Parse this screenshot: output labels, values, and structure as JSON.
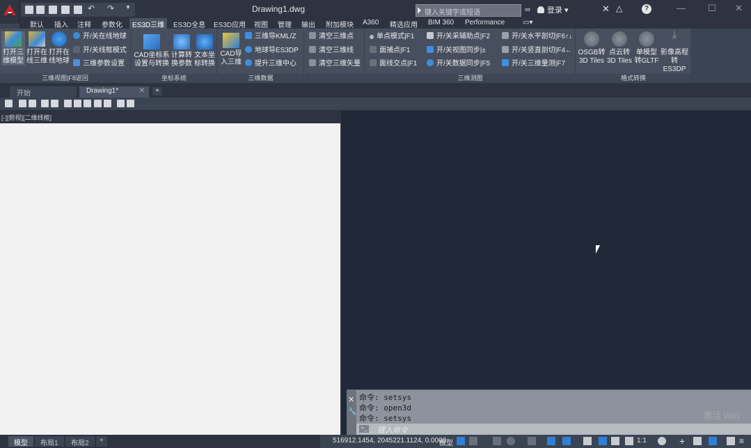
{
  "title": "Drawing1.dwg",
  "search": {
    "placeholder": "键入关键字或短语"
  },
  "login": "登录",
  "menu_tabs": [
    "默认",
    "插入",
    "注释",
    "参数化",
    "ES3D三维",
    "ES3D全息",
    "ES3D应用",
    "视图",
    "管理",
    "输出",
    "附加模块",
    "A360",
    "精选应用",
    "BIM 360",
    "Performance"
  ],
  "ribbon": {
    "panel1": {
      "title": "三维视图|F8返回",
      "big": [
        {
          "label1": "打开三",
          "label2": "维模型"
        },
        {
          "label1": "打开在",
          "label2": "线三维"
        },
        {
          "label1": "打开在",
          "label2": "线地球"
        }
      ],
      "small": [
        "开/关在线地球",
        "开/关线框模式",
        "三维参数设置"
      ]
    },
    "panel2": {
      "title": "坐标系统",
      "big": [
        {
          "label1": "CAD坐标系",
          "label2": "设置与转换"
        },
        {
          "label1": "计算转",
          "label2": "换参数"
        },
        {
          "label1": "文本坐",
          "label2": "标转换"
        }
      ]
    },
    "panel3": {
      "title": "三维数据",
      "big": [
        {
          "label1": "CAD导",
          "label2": "入三维"
        }
      ],
      "small": [
        "三维导KML/Z",
        "地球导ES3DP",
        "提升三维中心"
      ]
    },
    "panel4": {
      "small": [
        "清空三维点",
        "清空三维线",
        "清空三维矢量"
      ]
    },
    "panel5": {
      "title": "三维测图",
      "small": [
        "单点模式|F1",
        "面捕点|F1",
        "面线交点|F1",
        "开/关采辅助点|F2",
        "开/关视图同步|±",
        "开/关数据同步|F5",
        "开/关水平剖切|F6↑↓",
        "开/关竖直剖切|F4←",
        "开/关三维量测|F7"
      ]
    },
    "panel6": {
      "title": "格式转换",
      "big": [
        {
          "label1": "OSGB转",
          "label2": "3D Tiles"
        },
        {
          "label1": "点云转",
          "label2": "3D Tiles"
        },
        {
          "label1": "单模型",
          "label2": "转GLTF"
        },
        {
          "label1": "影像高程",
          "label2": "转ES3DP"
        }
      ]
    }
  },
  "doc_tabs": {
    "start": "开始",
    "drawing": "Drawing1*",
    "plus": "+"
  },
  "viewport_label": "[-][俯视][二维线框]",
  "command": {
    "history": [
      "命令: setsys",
      "命令: open3d",
      "命令: setsys"
    ],
    "placeholder": "键入命令"
  },
  "layout_tabs": [
    "模型",
    "布局1",
    "布局2"
  ],
  "status": {
    "coords": "516912.1454, 2045221.1124, 0.0000",
    "mode": "模型",
    "scale": "1:1"
  },
  "watermark": "激活 Win"
}
